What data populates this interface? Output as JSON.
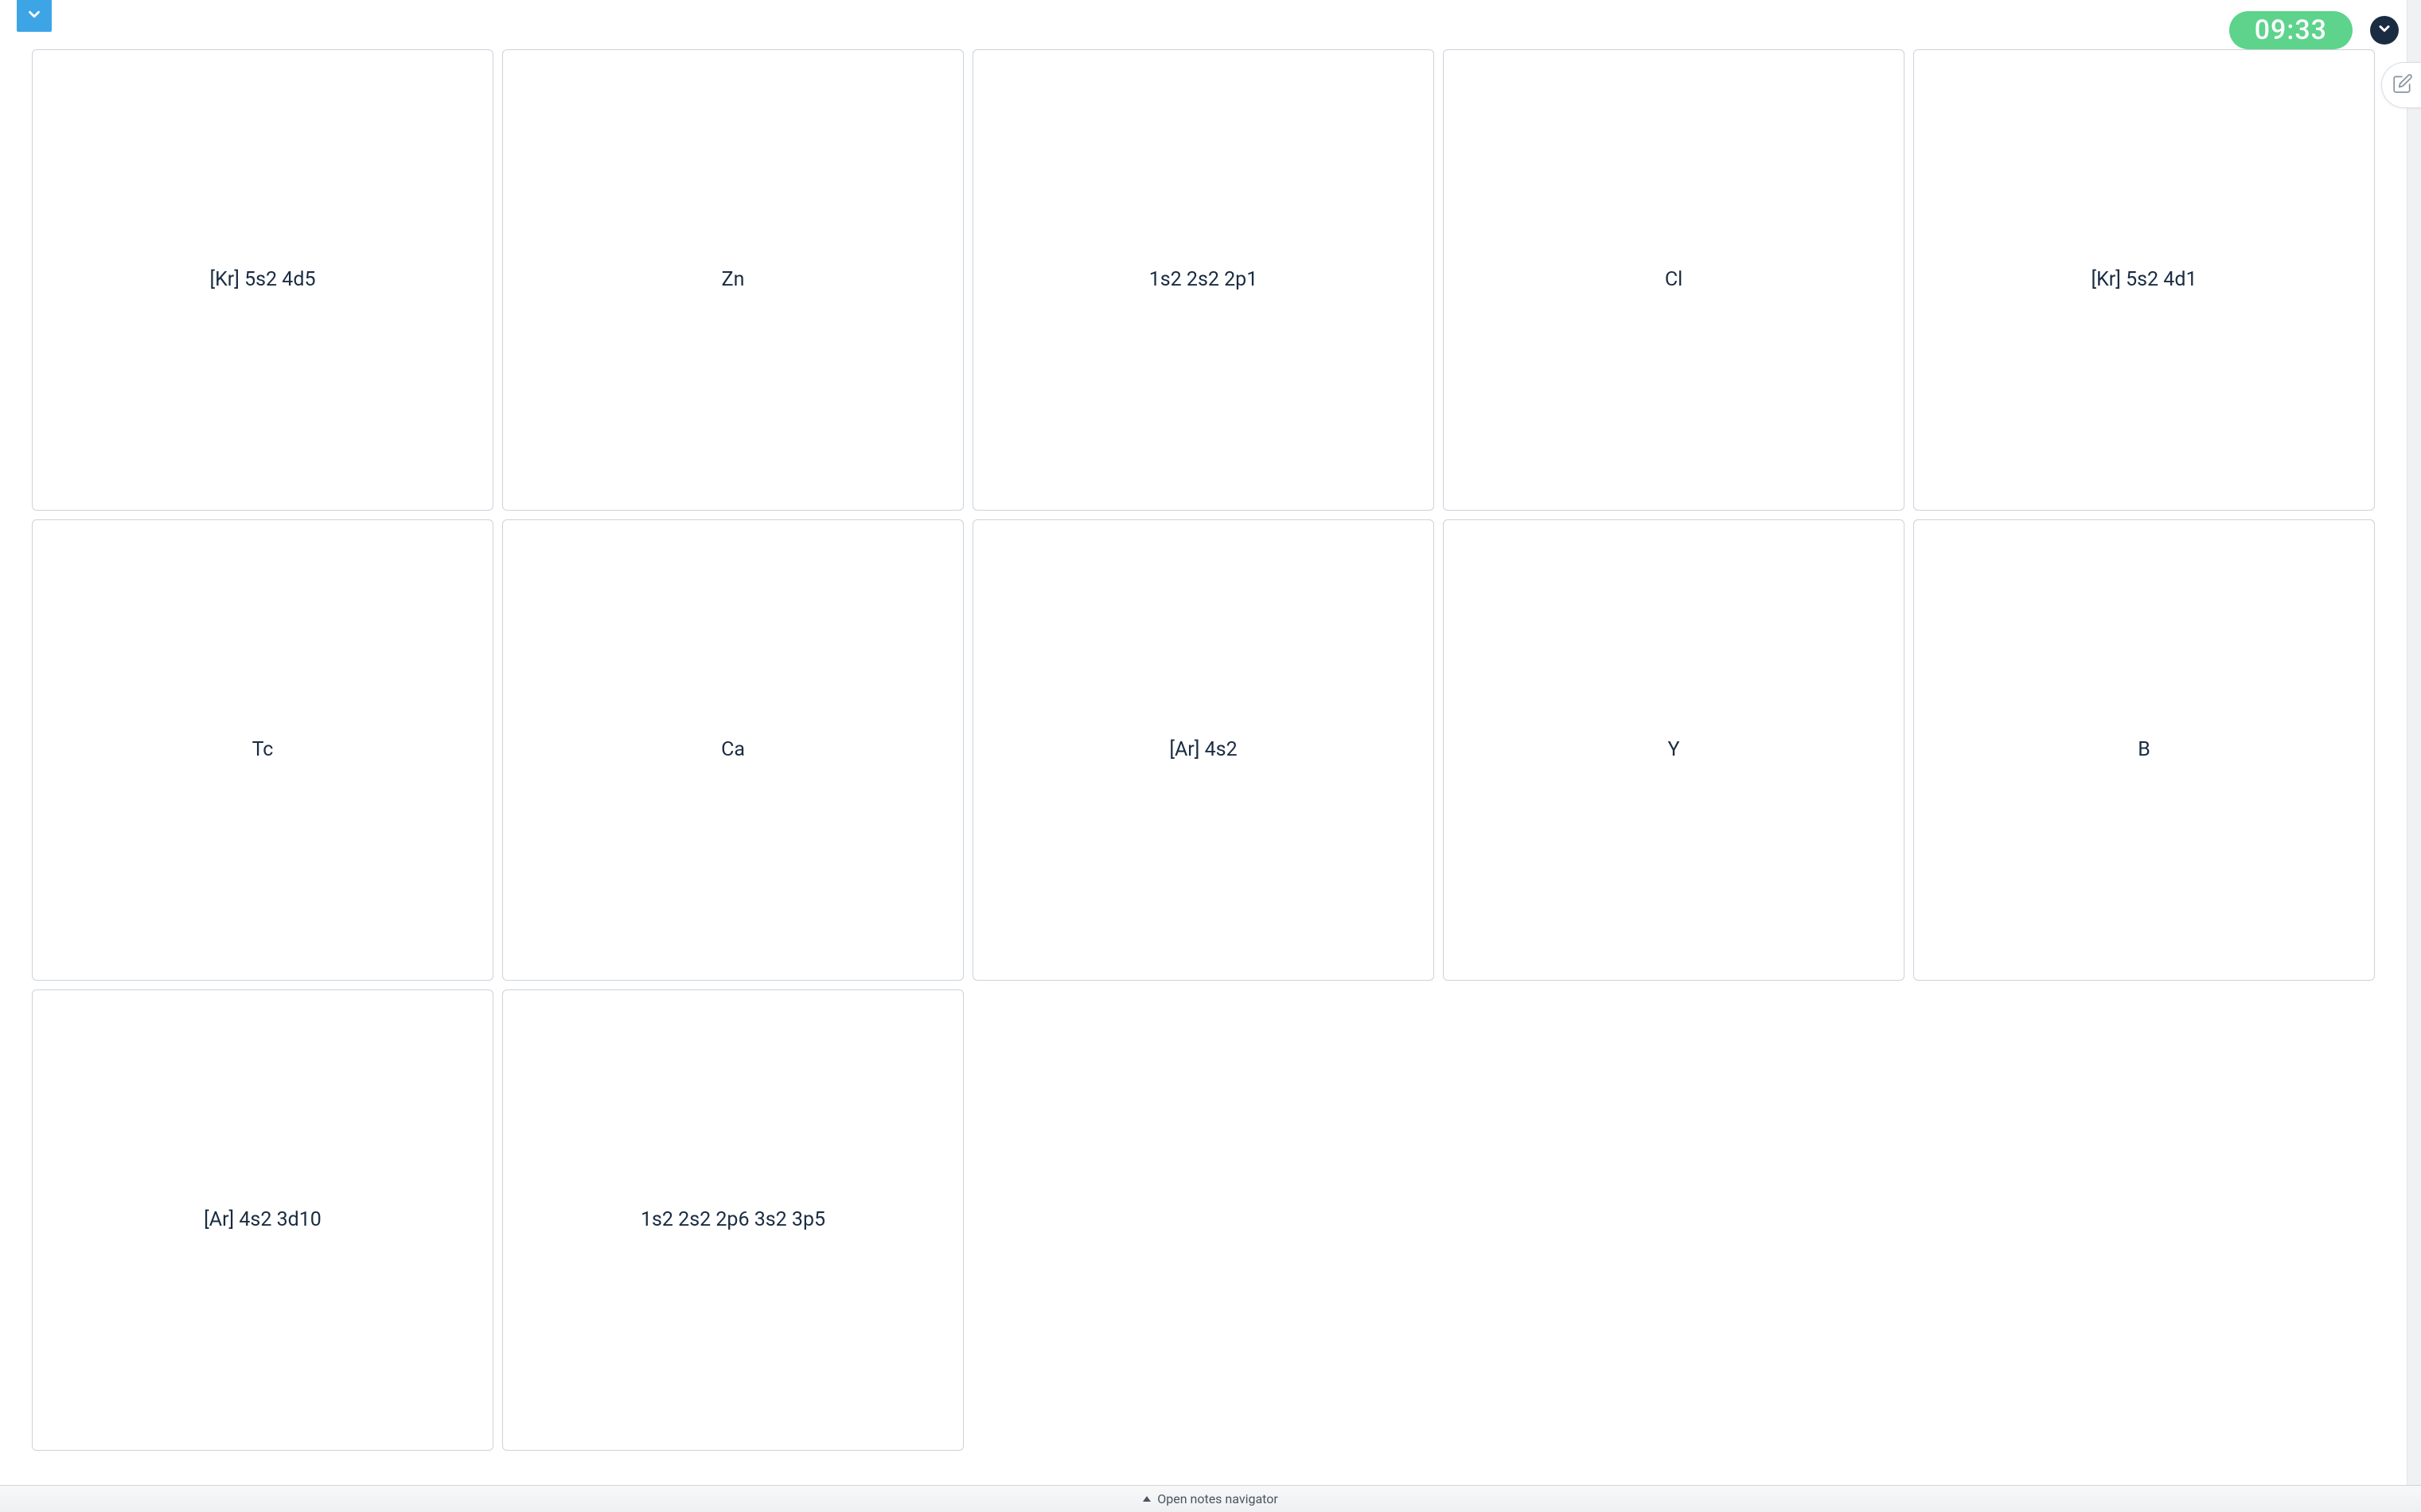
{
  "timer": "09:33",
  "footer": {
    "label": "Open notes navigator"
  },
  "cards": [
    {
      "label": "[Kr] 5s2 4d5"
    },
    {
      "label": "Zn"
    },
    {
      "label": "1s2 2s2 2p1"
    },
    {
      "label": "Cl"
    },
    {
      "label": "[Kr] 5s2 4d1"
    },
    {
      "label": "Tc"
    },
    {
      "label": "Ca"
    },
    {
      "label": "[Ar] 4s2"
    },
    {
      "label": "Y"
    },
    {
      "label": "B"
    },
    {
      "label": "[Ar] 4s2 3d10"
    },
    {
      "label": "1s2 2s2 2p6 3s2 3p5"
    }
  ]
}
